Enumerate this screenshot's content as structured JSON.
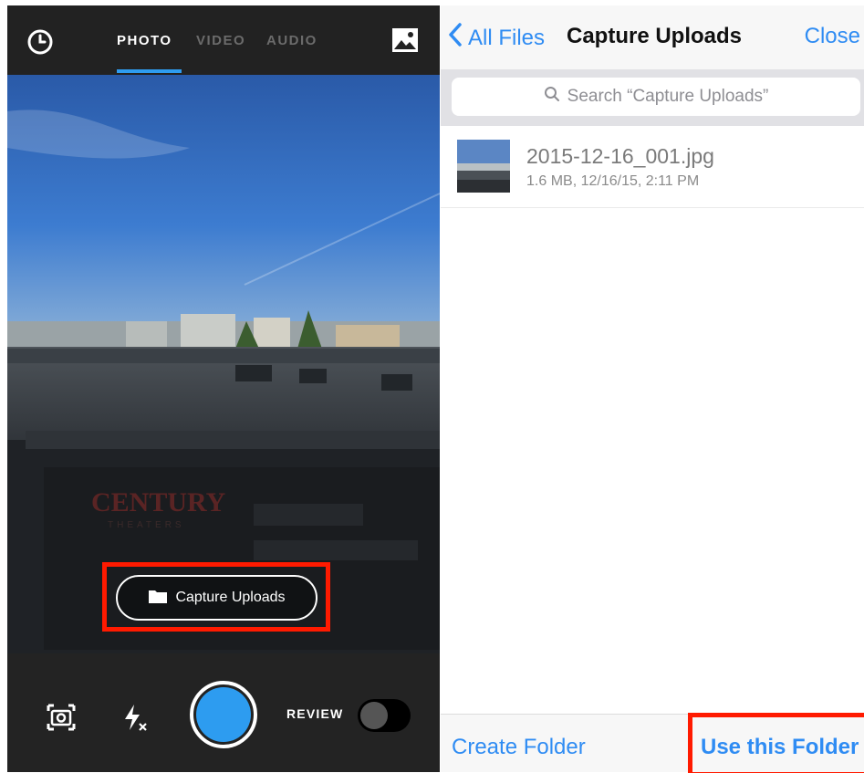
{
  "colors": {
    "accent_blue": "#2f8cf3",
    "shutter_blue": "#2d9cf0",
    "highlight_red": "#ff1a00",
    "tab_inactive": "#6b6b6b",
    "tab_active": "#ffffff",
    "underline": "#2e9cf0"
  },
  "camera": {
    "tabs": [
      {
        "label": "PHOTO",
        "active": true
      },
      {
        "label": "VIDEO",
        "active": false
      },
      {
        "label": "AUDIO",
        "active": false
      }
    ],
    "top_left_icon": "clock-icon",
    "top_right_icon": "gallery-icon",
    "folder_button": {
      "label": "Capture Uploads",
      "icon": "folder-icon"
    },
    "bottom_icons": [
      "camera-flip-icon",
      "flash-off-icon"
    ],
    "review_label": "REVIEW",
    "review_toggle_on": false
  },
  "picker": {
    "back_label": "All Files",
    "title": "Capture Uploads",
    "close_label": "Close",
    "search_placeholder": "Search “Capture Uploads”",
    "files": [
      {
        "name": "2015-12-16_001.jpg",
        "meta": "1.6 MB, 12/16/15, 2:11 PM"
      }
    ],
    "create_folder_label": "Create Folder",
    "use_folder_label": "Use this Folder"
  }
}
